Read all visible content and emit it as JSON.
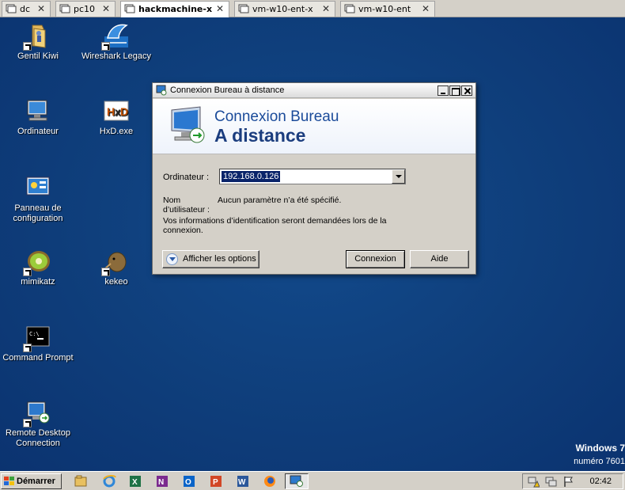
{
  "tabs": [
    {
      "label": "dc",
      "close": "✕"
    },
    {
      "label": "pc10",
      "close": "✕"
    },
    {
      "label": "hackmachine-x",
      "close": "✕",
      "active": true
    },
    {
      "label": "vm-w10-ent-x",
      "close": "✕"
    },
    {
      "label": "vm-w10-ent",
      "close": "✕"
    }
  ],
  "desktop_icons": [
    {
      "label": "Gentil Kiwi",
      "icon": "folder-icon"
    },
    {
      "label": "Wireshark Legacy",
      "icon": "wireshark-icon"
    },
    {
      "label": "Ordinateur",
      "icon": "computer-icon"
    },
    {
      "label": "HxD.exe",
      "icon": "hxd-icon"
    },
    {
      "label": "Panneau de configuration",
      "icon": "control-panel-icon"
    },
    {
      "label": "mimikatz",
      "icon": "kiwi-icon"
    },
    {
      "label": "kekeo",
      "icon": "kiwi-bird-icon"
    },
    {
      "label": "Command Prompt",
      "icon": "cmd-icon"
    },
    {
      "label": "Remote Desktop Connection",
      "icon": "remote-desktop-icon"
    }
  ],
  "watermark": {
    "line1": "Windows 7",
    "line2": "numéro 7601"
  },
  "dialog": {
    "title": "Connexion Bureau à distance",
    "banner_line1": "Connexion Bureau",
    "banner_line2": "A distance",
    "computer_label": "Ordinateur :",
    "computer_value": "192.168.0.126",
    "username_label": "Nom d’utilisateur :",
    "username_value": "Aucun paramètre n’a été spécifié.",
    "info_text": "Vos informations d’identification seront demandées lors de la connexion.",
    "options_button": "Afficher les options",
    "connect_button": "Connexion",
    "help_button": "Aide"
  },
  "taskbar": {
    "start_label": "Démarrer",
    "clock": "02:42",
    "quick_launch": [
      "explorer-icon",
      "ie-icon",
      "excel-icon",
      "onenote-icon",
      "outlook-icon",
      "powerpoint-icon",
      "word-icon",
      "firefox-icon"
    ]
  },
  "colors": {
    "desktop": "#0f3d7a",
    "banner_title": "#1b4b9a",
    "selection": "#0a246a"
  }
}
